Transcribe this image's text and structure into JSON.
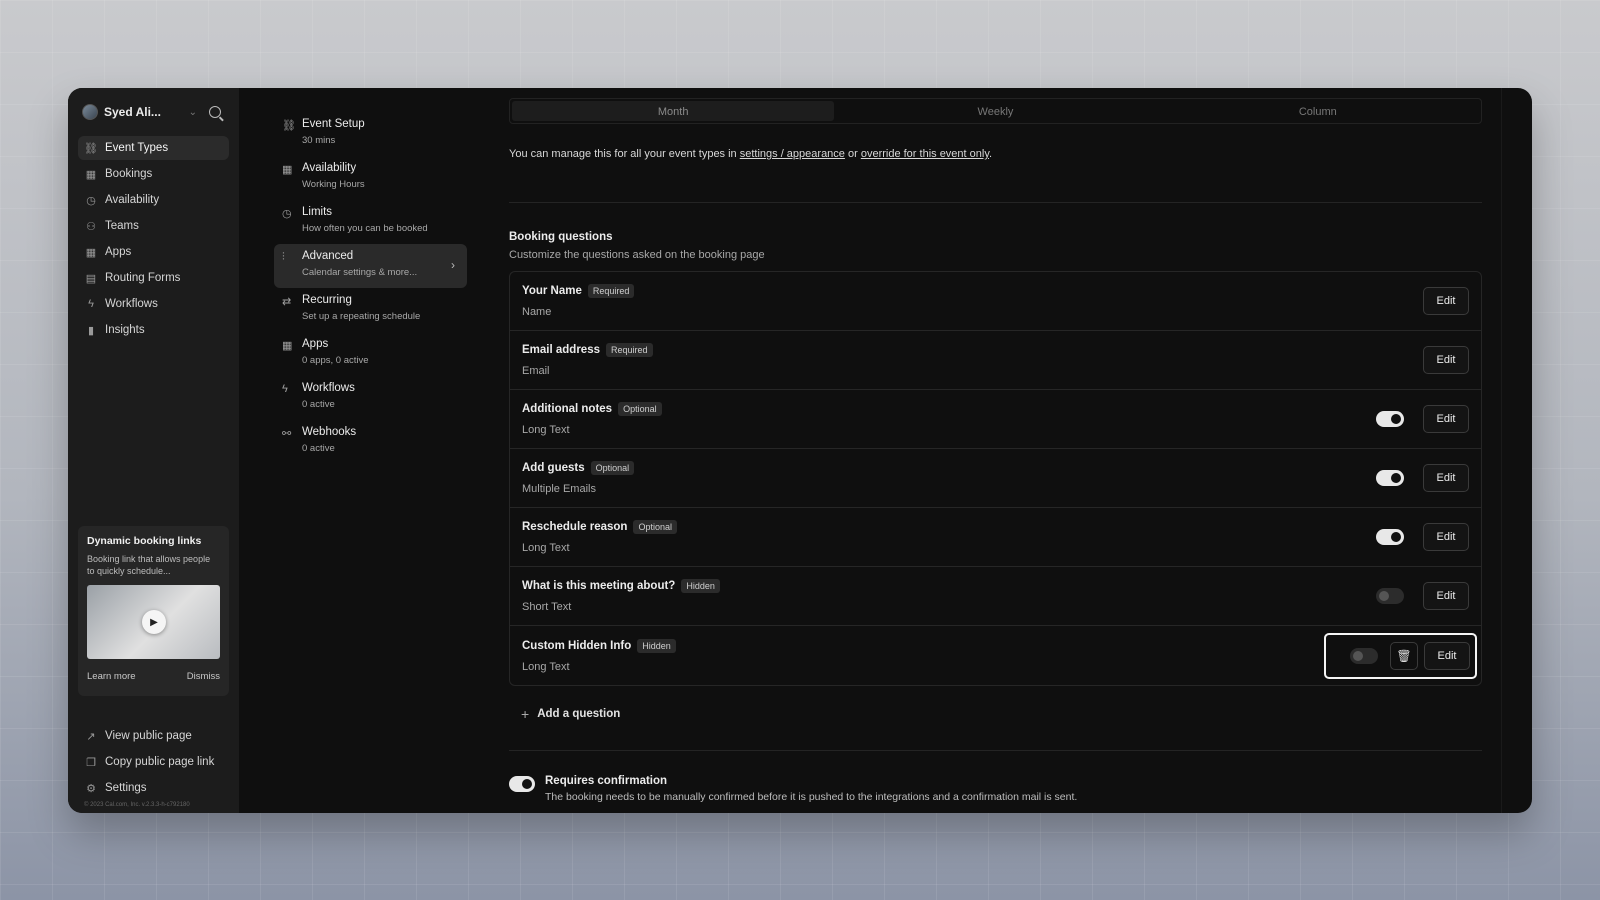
{
  "user": {
    "name": "Syed Ali..."
  },
  "sidebar": {
    "items": [
      {
        "label": "Event Types",
        "icon": "link-icon"
      },
      {
        "label": "Bookings",
        "icon": "calendar-icon"
      },
      {
        "label": "Availability",
        "icon": "clock-icon"
      },
      {
        "label": "Teams",
        "icon": "users-icon"
      },
      {
        "label": "Apps",
        "icon": "grid-icon"
      },
      {
        "label": "Routing Forms",
        "icon": "file-icon"
      },
      {
        "label": "Workflows",
        "icon": "zap-icon"
      },
      {
        "label": "Insights",
        "icon": "bar-chart-icon"
      }
    ],
    "promo": {
      "title": "Dynamic booking links",
      "description": "Booking link that allows people to quickly schedule...",
      "learn_more": "Learn more",
      "dismiss": "Dismiss"
    },
    "bottom": [
      {
        "label": "View public page",
        "icon": "external-link-icon"
      },
      {
        "label": "Copy public page link",
        "icon": "copy-icon"
      },
      {
        "label": "Settings",
        "icon": "gear-icon"
      }
    ],
    "copyright": "© 2023 Cal.com, Inc. v.2.3.3-h-c792180"
  },
  "settings_nav": [
    {
      "title": "Event Setup",
      "subtitle": "30 mins",
      "icon": "link-icon"
    },
    {
      "title": "Availability",
      "subtitle": "Working Hours",
      "icon": "calendar-icon"
    },
    {
      "title": "Limits",
      "subtitle": "How often you can be booked",
      "icon": "clock-icon"
    },
    {
      "title": "Advanced",
      "subtitle": "Calendar settings & more...",
      "icon": "sliders-icon"
    },
    {
      "title": "Recurring",
      "subtitle": "Set up a repeating schedule",
      "icon": "repeat-icon"
    },
    {
      "title": "Apps",
      "subtitle": "0 apps, 0 active",
      "icon": "grid-icon"
    },
    {
      "title": "Workflows",
      "subtitle": "0 active",
      "icon": "zap-icon"
    },
    {
      "title": "Webhooks",
      "subtitle": "0 active",
      "icon": "webhook-icon"
    }
  ],
  "layout_tabs": [
    "Month",
    "Weekly",
    "Column"
  ],
  "manage": {
    "prefix": "You can manage this for all your event types in ",
    "link1": "settings / appearance",
    "middle": " or ",
    "link2": "override for this event only",
    "suffix": "."
  },
  "booking_questions": {
    "title": "Booking questions",
    "subtitle": "Customize the questions asked on the booking page",
    "edit_label": "Edit",
    "questions": [
      {
        "name": "Your Name",
        "badge": "Required",
        "type": "Name"
      },
      {
        "name": "Email address",
        "badge": "Required",
        "type": "Email"
      },
      {
        "name": "Additional notes",
        "badge": "Optional",
        "type": "Long Text"
      },
      {
        "name": "Add guests",
        "badge": "Optional",
        "type": "Multiple Emails"
      },
      {
        "name": "Reschedule reason",
        "badge": "Optional",
        "type": "Long Text"
      },
      {
        "name": "What is this meeting about?",
        "badge": "Hidden",
        "type": "Short Text"
      },
      {
        "name": "Custom Hidden Info",
        "badge": "Hidden",
        "type": "Long Text"
      }
    ],
    "add_question": "Add a question"
  },
  "requires_confirmation": {
    "title": "Requires confirmation",
    "description": "The booking needs to be manually confirmed before it is pushed to the integrations and a confirmation mail is sent."
  }
}
